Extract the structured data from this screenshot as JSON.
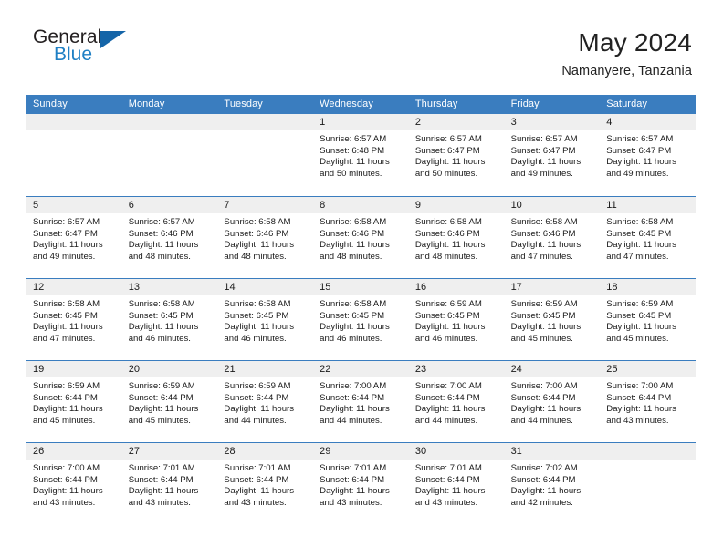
{
  "logo": {
    "word_one": "General",
    "word_two": "Blue",
    "triangle_icon": "triangle-icon"
  },
  "header": {
    "title": "May 2024",
    "subtitle": "Namanyere, Tanzania"
  },
  "theme": {
    "header_blue": "#3a7dbf",
    "logo_blue": "#1f7fc4",
    "day_head_gray": "#efefef",
    "text": "#1a1a1a"
  },
  "weekdays": [
    "Sunday",
    "Monday",
    "Tuesday",
    "Wednesday",
    "Thursday",
    "Friday",
    "Saturday"
  ],
  "weeks": [
    [
      {
        "day": "",
        "lines": []
      },
      {
        "day": "",
        "lines": []
      },
      {
        "day": "",
        "lines": []
      },
      {
        "day": "1",
        "lines": [
          "Sunrise: 6:57 AM",
          "Sunset: 6:48 PM",
          "Daylight: 11 hours",
          "and 50 minutes."
        ]
      },
      {
        "day": "2",
        "lines": [
          "Sunrise: 6:57 AM",
          "Sunset: 6:47 PM",
          "Daylight: 11 hours",
          "and 50 minutes."
        ]
      },
      {
        "day": "3",
        "lines": [
          "Sunrise: 6:57 AM",
          "Sunset: 6:47 PM",
          "Daylight: 11 hours",
          "and 49 minutes."
        ]
      },
      {
        "day": "4",
        "lines": [
          "Sunrise: 6:57 AM",
          "Sunset: 6:47 PM",
          "Daylight: 11 hours",
          "and 49 minutes."
        ]
      }
    ],
    [
      {
        "day": "5",
        "lines": [
          "Sunrise: 6:57 AM",
          "Sunset: 6:47 PM",
          "Daylight: 11 hours",
          "and 49 minutes."
        ]
      },
      {
        "day": "6",
        "lines": [
          "Sunrise: 6:57 AM",
          "Sunset: 6:46 PM",
          "Daylight: 11 hours",
          "and 48 minutes."
        ]
      },
      {
        "day": "7",
        "lines": [
          "Sunrise: 6:58 AM",
          "Sunset: 6:46 PM",
          "Daylight: 11 hours",
          "and 48 minutes."
        ]
      },
      {
        "day": "8",
        "lines": [
          "Sunrise: 6:58 AM",
          "Sunset: 6:46 PM",
          "Daylight: 11 hours",
          "and 48 minutes."
        ]
      },
      {
        "day": "9",
        "lines": [
          "Sunrise: 6:58 AM",
          "Sunset: 6:46 PM",
          "Daylight: 11 hours",
          "and 48 minutes."
        ]
      },
      {
        "day": "10",
        "lines": [
          "Sunrise: 6:58 AM",
          "Sunset: 6:46 PM",
          "Daylight: 11 hours",
          "and 47 minutes."
        ]
      },
      {
        "day": "11",
        "lines": [
          "Sunrise: 6:58 AM",
          "Sunset: 6:45 PM",
          "Daylight: 11 hours",
          "and 47 minutes."
        ]
      }
    ],
    [
      {
        "day": "12",
        "lines": [
          "Sunrise: 6:58 AM",
          "Sunset: 6:45 PM",
          "Daylight: 11 hours",
          "and 47 minutes."
        ]
      },
      {
        "day": "13",
        "lines": [
          "Sunrise: 6:58 AM",
          "Sunset: 6:45 PM",
          "Daylight: 11 hours",
          "and 46 minutes."
        ]
      },
      {
        "day": "14",
        "lines": [
          "Sunrise: 6:58 AM",
          "Sunset: 6:45 PM",
          "Daylight: 11 hours",
          "and 46 minutes."
        ]
      },
      {
        "day": "15",
        "lines": [
          "Sunrise: 6:58 AM",
          "Sunset: 6:45 PM",
          "Daylight: 11 hours",
          "and 46 minutes."
        ]
      },
      {
        "day": "16",
        "lines": [
          "Sunrise: 6:59 AM",
          "Sunset: 6:45 PM",
          "Daylight: 11 hours",
          "and 46 minutes."
        ]
      },
      {
        "day": "17",
        "lines": [
          "Sunrise: 6:59 AM",
          "Sunset: 6:45 PM",
          "Daylight: 11 hours",
          "and 45 minutes."
        ]
      },
      {
        "day": "18",
        "lines": [
          "Sunrise: 6:59 AM",
          "Sunset: 6:45 PM",
          "Daylight: 11 hours",
          "and 45 minutes."
        ]
      }
    ],
    [
      {
        "day": "19",
        "lines": [
          "Sunrise: 6:59 AM",
          "Sunset: 6:44 PM",
          "Daylight: 11 hours",
          "and 45 minutes."
        ]
      },
      {
        "day": "20",
        "lines": [
          "Sunrise: 6:59 AM",
          "Sunset: 6:44 PM",
          "Daylight: 11 hours",
          "and 45 minutes."
        ]
      },
      {
        "day": "21",
        "lines": [
          "Sunrise: 6:59 AM",
          "Sunset: 6:44 PM",
          "Daylight: 11 hours",
          "and 44 minutes."
        ]
      },
      {
        "day": "22",
        "lines": [
          "Sunrise: 7:00 AM",
          "Sunset: 6:44 PM",
          "Daylight: 11 hours",
          "and 44 minutes."
        ]
      },
      {
        "day": "23",
        "lines": [
          "Sunrise: 7:00 AM",
          "Sunset: 6:44 PM",
          "Daylight: 11 hours",
          "and 44 minutes."
        ]
      },
      {
        "day": "24",
        "lines": [
          "Sunrise: 7:00 AM",
          "Sunset: 6:44 PM",
          "Daylight: 11 hours",
          "and 44 minutes."
        ]
      },
      {
        "day": "25",
        "lines": [
          "Sunrise: 7:00 AM",
          "Sunset: 6:44 PM",
          "Daylight: 11 hours",
          "and 43 minutes."
        ]
      }
    ],
    [
      {
        "day": "26",
        "lines": [
          "Sunrise: 7:00 AM",
          "Sunset: 6:44 PM",
          "Daylight: 11 hours",
          "and 43 minutes."
        ]
      },
      {
        "day": "27",
        "lines": [
          "Sunrise: 7:01 AM",
          "Sunset: 6:44 PM",
          "Daylight: 11 hours",
          "and 43 minutes."
        ]
      },
      {
        "day": "28",
        "lines": [
          "Sunrise: 7:01 AM",
          "Sunset: 6:44 PM",
          "Daylight: 11 hours",
          "and 43 minutes."
        ]
      },
      {
        "day": "29",
        "lines": [
          "Sunrise: 7:01 AM",
          "Sunset: 6:44 PM",
          "Daylight: 11 hours",
          "and 43 minutes."
        ]
      },
      {
        "day": "30",
        "lines": [
          "Sunrise: 7:01 AM",
          "Sunset: 6:44 PM",
          "Daylight: 11 hours",
          "and 43 minutes."
        ]
      },
      {
        "day": "31",
        "lines": [
          "Sunrise: 7:02 AM",
          "Sunset: 6:44 PM",
          "Daylight: 11 hours",
          "and 42 minutes."
        ]
      },
      {
        "day": "",
        "lines": []
      }
    ]
  ]
}
